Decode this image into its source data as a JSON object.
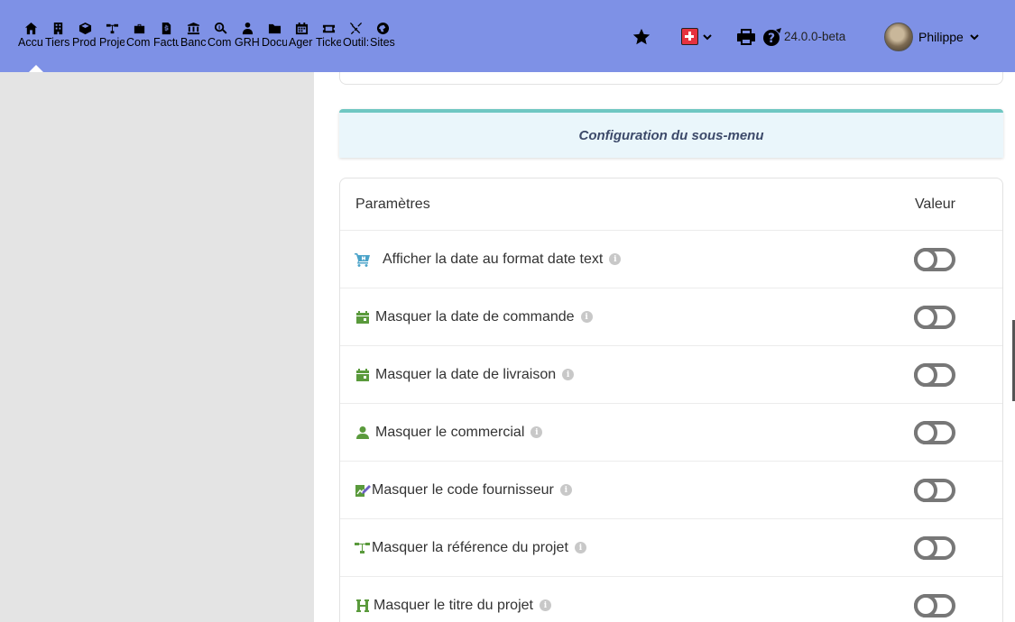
{
  "nav": {
    "items": [
      {
        "label": "Accueil",
        "icon": "home-icon"
      },
      {
        "label": "Tiers",
        "icon": "building-icon"
      },
      {
        "label": "Produits",
        "icon": "cube-icon"
      },
      {
        "label": "Projets",
        "icon": "project-tree-icon"
      },
      {
        "label": "Commercial",
        "icon": "briefcase-icon"
      },
      {
        "label": "Facturation",
        "icon": "invoice-icon"
      },
      {
        "label": "Banque",
        "icon": "bank-icon"
      },
      {
        "label": "Compta",
        "icon": "search-dollar-icon"
      },
      {
        "label": "GRH",
        "icon": "users-icon"
      },
      {
        "label": "Documents",
        "icon": "folder-icon"
      },
      {
        "label": "Agenda",
        "icon": "calendar-icon"
      },
      {
        "label": "Tickets",
        "icon": "ticket-icon"
      },
      {
        "label": "Outils",
        "icon": "tools-icon"
      },
      {
        "label": "Sites",
        "icon": "globe-icon"
      }
    ],
    "display_labels": [
      "Accu",
      "Tiers",
      "Prod",
      "Proje",
      "Com",
      "Factu",
      "Banc",
      "Com",
      "GRH",
      "Docu",
      "Ager",
      "Ticke",
      "Outil:",
      "Sites"
    ]
  },
  "topright": {
    "version": "24.0.0-beta",
    "user_name": "Philippe"
  },
  "banner": {
    "title": "Configuration du sous-menu"
  },
  "table": {
    "col_param": "Paramètres",
    "col_value": "Valeur",
    "rows": [
      {
        "label": "Afficher la date au format date text",
        "icon": "cart-icon",
        "icon_color": "#4aa3c9",
        "enabled": false
      },
      {
        "label": "Masquer la date de commande",
        "icon": "calendar-icon",
        "icon_color": "#5a9a3c",
        "enabled": false
      },
      {
        "label": "Masquer la date de livraison",
        "icon": "calendar-icon",
        "icon_color": "#5a9a3c",
        "enabled": false
      },
      {
        "label": "Masquer le commercial",
        "icon": "user-icon",
        "icon_color": "#5a9a3c",
        "enabled": false
      },
      {
        "label": "Masquer le code fournisseur",
        "icon": "supplier-icon",
        "icon_color": "#5a9a3c",
        "enabled": false
      },
      {
        "label": "Masquer la référence du projet",
        "icon": "project-tree-icon",
        "icon_color": "#5a9a3c",
        "enabled": false
      },
      {
        "label": "Masquer le titre du projet",
        "icon": "heading-icon",
        "icon_color": "#5a9a3c",
        "enabled": false
      }
    ]
  },
  "colors": {
    "topbar": "#7e91e6",
    "sidebar": "#e4e4e4",
    "banner_bg": "#eaf6fb",
    "banner_border": "#6fc7c2",
    "icon_green": "#5a9a3c"
  }
}
